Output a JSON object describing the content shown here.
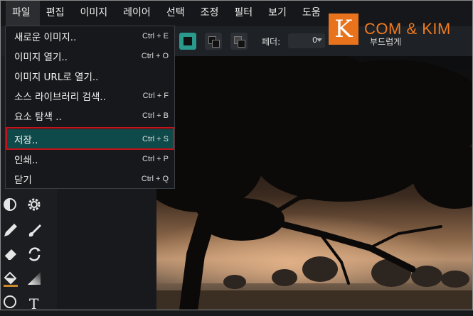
{
  "menubar": {
    "items": [
      {
        "label": "파일"
      },
      {
        "label": "편집"
      },
      {
        "label": "이미지"
      },
      {
        "label": "레이어"
      },
      {
        "label": "선택"
      },
      {
        "label": "조정"
      },
      {
        "label": "필터"
      },
      {
        "label": "보기"
      },
      {
        "label": "도움"
      }
    ]
  },
  "file_menu": {
    "items": [
      {
        "label": "새로운 이미지..",
        "shortcut": "Ctrl + E"
      },
      {
        "label": "이미지 열기..",
        "shortcut": "Ctrl + O"
      },
      {
        "label": "이미지 URL로 열기..",
        "shortcut": ""
      },
      {
        "label": "소스 라이브러리 검색..",
        "shortcut": "Ctrl + F"
      },
      {
        "label": "요소 탐색 ..",
        "shortcut": "Ctrl + B"
      },
      {
        "label": "저장..",
        "shortcut": "Ctrl + S"
      },
      {
        "label": "인쇄..",
        "shortcut": "Ctrl + P"
      },
      {
        "label": "닫기",
        "shortcut": "Ctrl + Q"
      }
    ],
    "highlighted": "저장.."
  },
  "options_bar": {
    "feather_label": "페더:",
    "feather_value": "0",
    "smooth_label": "부드럽게"
  },
  "logo": {
    "letter": "K",
    "text": "COM & KIM"
  },
  "colors": {
    "highlight": "#0f4a4a",
    "annotation_box": "#c2141c",
    "logo_orange": "#e8731c",
    "accent": "#2a9a8c"
  }
}
